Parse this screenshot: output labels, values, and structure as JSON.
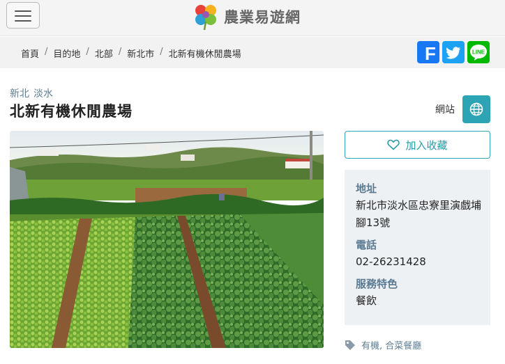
{
  "header": {
    "site_name": "農業易遊網",
    "logo_icon": "clover-logo-icon"
  },
  "breadcrumb": [
    "首頁",
    "目的地",
    "北部",
    "新北市",
    "北新有機休閒農場"
  ],
  "share": {
    "facebook": "F",
    "twitter": "twitter-bird-icon",
    "line": "LINE"
  },
  "place": {
    "city": "新北",
    "district": "淡水",
    "title": "北新有機休閒農場",
    "website_label": "網站"
  },
  "favorite": {
    "label": "加入收藏"
  },
  "info": {
    "address_label": "地址",
    "address": "新北市淡水區忠寮里演戲埔腳13號",
    "phone_label": "電話",
    "phone": "02-26231428",
    "feature_label": "服務特色",
    "feature": "餐飲"
  },
  "tags": "有機, 合菜餐廳",
  "colors": {
    "accent": "#2ca4b4",
    "label": "#5a7a92",
    "facebook": "#1877f2",
    "twitter": "#1da1f2",
    "line": "#00b900"
  }
}
